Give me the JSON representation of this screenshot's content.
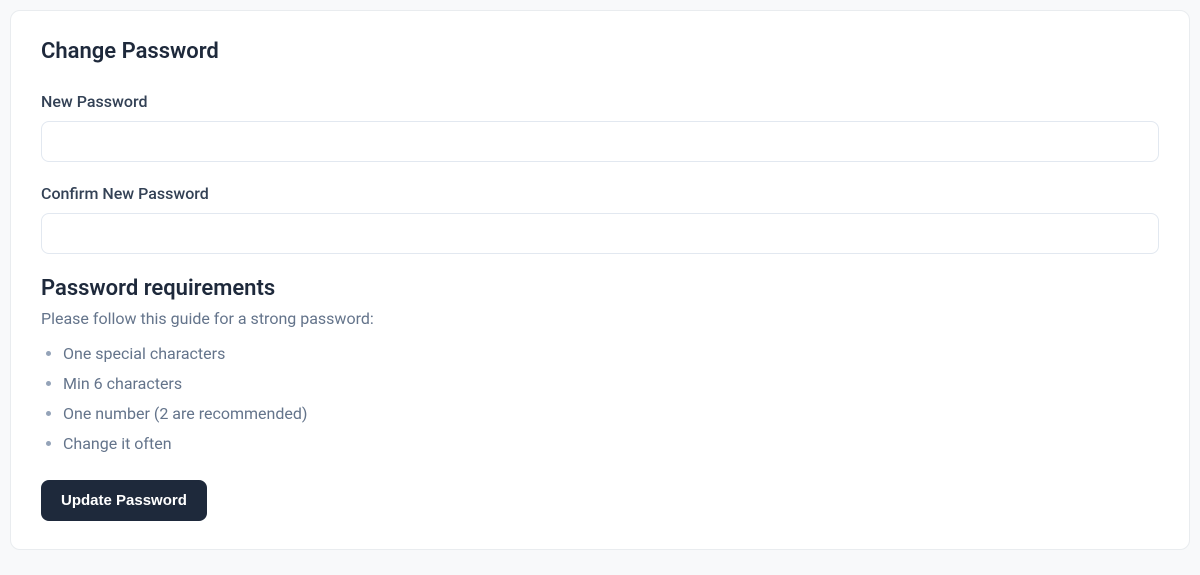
{
  "card": {
    "title": "Change Password"
  },
  "form": {
    "newPassword": {
      "label": "New Password",
      "value": ""
    },
    "confirmPassword": {
      "label": "Confirm New Password",
      "value": ""
    }
  },
  "requirements": {
    "title": "Password requirements",
    "subtitle": "Please follow this guide for a strong password:",
    "items": [
      "One special characters",
      "Min 6 characters",
      "One number (2 are recommended)",
      "Change it often"
    ]
  },
  "actions": {
    "updateLabel": "Update Password"
  }
}
